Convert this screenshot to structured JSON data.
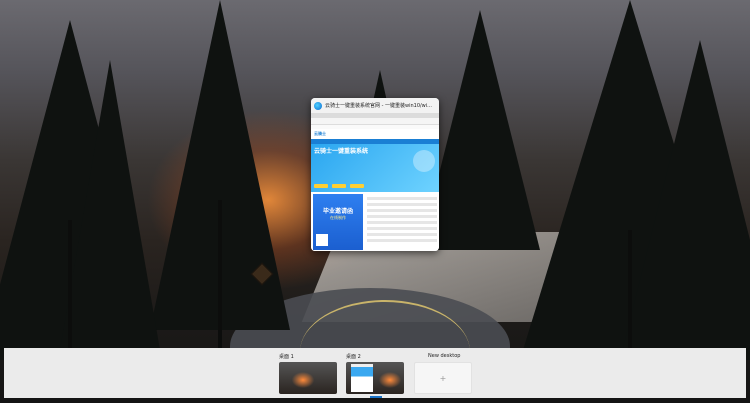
{
  "window": {
    "title": "云骑士一键重装系统官网 - 一键重装win10/wi...",
    "site_logo": "云骑士",
    "hero_title": "云骑士一键重装系统",
    "ad_title": "毕业邀请函",
    "ad_sub": "在线制作"
  },
  "desktops": [
    {
      "label": "桌面 1"
    },
    {
      "label": "桌面 2",
      "active": true
    },
    {
      "label": "New desktop",
      "plus": "+"
    }
  ],
  "colors": {
    "accent": "#1a73c8",
    "strip_bg": "#ebebeb"
  },
  "icons": {
    "browser": "edge-icon",
    "new": "plus-icon"
  }
}
